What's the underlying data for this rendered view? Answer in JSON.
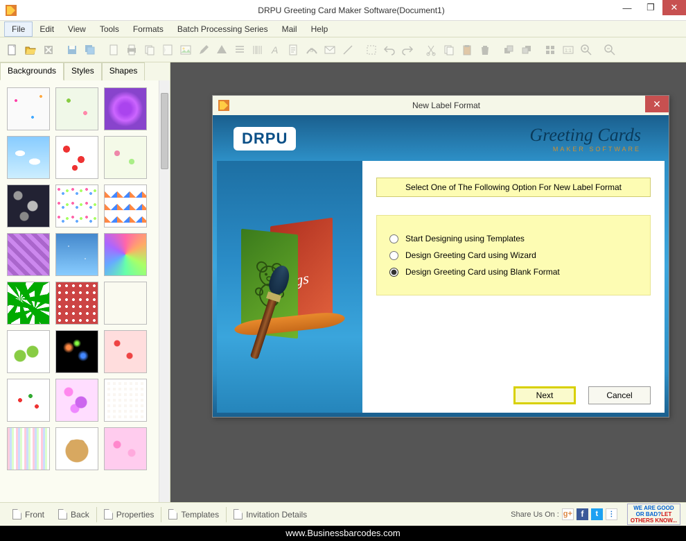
{
  "window": {
    "title": "DRPU Greeting Card Maker Software(Document1)"
  },
  "menu": {
    "items": [
      "File",
      "Edit",
      "View",
      "Tools",
      "Formats",
      "Batch Processing Series",
      "Mail",
      "Help"
    ],
    "active_index": 0
  },
  "sidebar": {
    "tabs": [
      "Backgrounds",
      "Styles",
      "Shapes"
    ],
    "active_tab": 0
  },
  "dialog": {
    "title": "New Label Format",
    "brand": "DRPU",
    "brand_script": "Greeting Cards",
    "brand_sub": "MAKER SOFTWARE",
    "card_text": "dings",
    "prompt": "Select One of The Following Option For New Label Format",
    "options": [
      "Start Designing using Templates",
      "Design Greeting Card using Wizard",
      "Design Greeting Card using Blank Format"
    ],
    "selected_option": 2,
    "next": "Next",
    "cancel": "Cancel"
  },
  "bottombar": {
    "items": [
      "Front",
      "Back",
      "Properties",
      "Templates",
      "Invitation Details"
    ],
    "share_label": "Share Us On :",
    "badge_line1": "WE ARE GOOD",
    "badge_line2a": "OR BAD?",
    "badge_line2b": "LET",
    "badge_line3": "OTHERS KNOW..."
  },
  "footer": {
    "url": "www.Businessbarcodes.com"
  }
}
